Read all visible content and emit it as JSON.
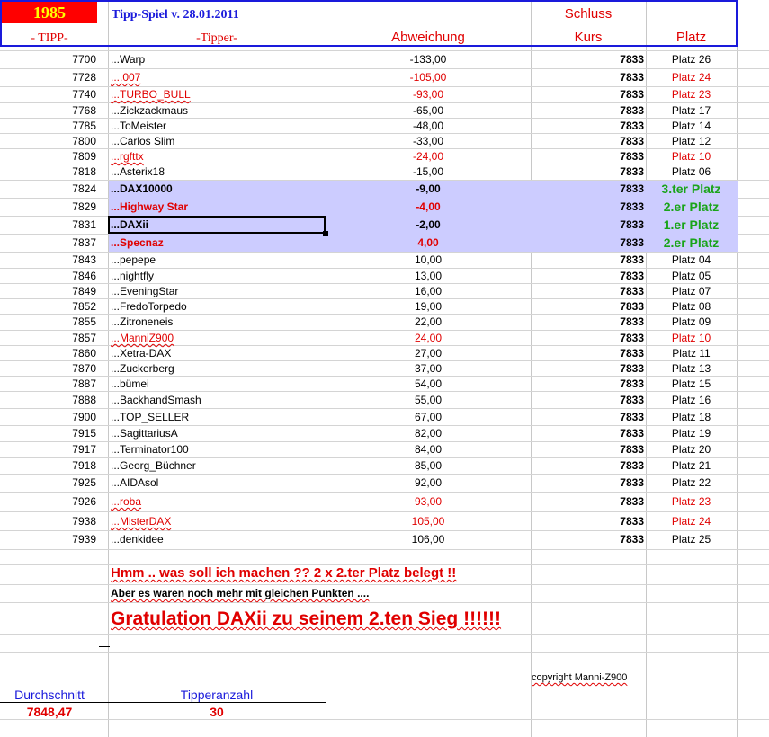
{
  "header": {
    "year": "1985",
    "title": "Tipp-Spiel v. 28.01.2011",
    "schluss": "Schluss",
    "col_tipp": "- TIPP-",
    "col_tipper": "-Tipper-",
    "col_abweichung": "Abweichung",
    "col_kurs": "Kurs",
    "col_platz": "Platz"
  },
  "rows": [
    {
      "tipp": "7700",
      "name": "...Warp",
      "abw": "-133,00",
      "kurs": "7833",
      "platz": "Platz 26",
      "style": "normal"
    },
    {
      "tipp": "7728",
      "name": "....007",
      "abw": "-105,00",
      "kurs": "7833",
      "platz": "Platz 24",
      "style": "red"
    },
    {
      "tipp": "7740",
      "name": "...TURBO_BULL",
      "abw": "-93,00",
      "kurs": "7833",
      "platz": "Platz 23",
      "style": "red"
    },
    {
      "tipp": "7768",
      "name": "...Zickzackmaus",
      "abw": "-65,00",
      "kurs": "7833",
      "platz": "Platz 17",
      "style": "normal"
    },
    {
      "tipp": "7785",
      "name": "...ToMeister",
      "abw": "-48,00",
      "kurs": "7833",
      "platz": "Platz 14",
      "style": "normal"
    },
    {
      "tipp": "7800",
      "name": "...Carlos Slim",
      "abw": "-33,00",
      "kurs": "7833",
      "platz": "Platz 12",
      "style": "normal"
    },
    {
      "tipp": "7809",
      "name": "...rgfttx",
      "abw": "-24,00",
      "kurs": "7833",
      "platz": "Platz 10",
      "style": "red"
    },
    {
      "tipp": "7818",
      "name": "...Asterix18",
      "abw": "-15,00",
      "kurs": "7833",
      "platz": "Platz 06",
      "style": "normal"
    },
    {
      "tipp": "7824",
      "name": "...DAX10000",
      "abw": "-9,00",
      "kurs": "7833",
      "platz": "3.ter Platz",
      "style": "hl"
    },
    {
      "tipp": "7829",
      "name": "...Highway Star",
      "abw": "-4,00",
      "kurs": "7833",
      "platz": "2.er Platz",
      "style": "hlred"
    },
    {
      "tipp": "7831",
      "name": "...DAXii",
      "abw": "-2,00",
      "kurs": "7833",
      "platz": "1.er Platz",
      "style": "hl"
    },
    {
      "tipp": "7837",
      "name": "...Specnaz",
      "abw": "4,00",
      "kurs": "7833",
      "platz": "2.er Platz",
      "style": "hlred"
    },
    {
      "tipp": "7843",
      "name": "...pepepe",
      "abw": "10,00",
      "kurs": "7833",
      "platz": "Platz 04",
      "style": "normal"
    },
    {
      "tipp": "7846",
      "name": "...nightfly",
      "abw": "13,00",
      "kurs": "7833",
      "platz": "Platz 05",
      "style": "normal"
    },
    {
      "tipp": "7849",
      "name": "...EveningStar",
      "abw": "16,00",
      "kurs": "7833",
      "platz": "Platz 07",
      "style": "normal"
    },
    {
      "tipp": "7852",
      "name": "...FredoTorpedo",
      "abw": "19,00",
      "kurs": "7833",
      "platz": "Platz 08",
      "style": "normal"
    },
    {
      "tipp": "7855",
      "name": "...Zitroneneis",
      "abw": "22,00",
      "kurs": "7833",
      "platz": "Platz 09",
      "style": "normal"
    },
    {
      "tipp": "7857",
      "name": "...ManniZ900",
      "abw": "24,00",
      "kurs": "7833",
      "platz": "Platz 10",
      "style": "red"
    },
    {
      "tipp": "7860",
      "name": "...Xetra-DAX",
      "abw": "27,00",
      "kurs": "7833",
      "platz": "Platz 11",
      "style": "normal"
    },
    {
      "tipp": "7870",
      "name": "...Zuckerberg",
      "abw": "37,00",
      "kurs": "7833",
      "platz": "Platz 13",
      "style": "normal"
    },
    {
      "tipp": "7887",
      "name": "...bümei",
      "abw": "54,00",
      "kurs": "7833",
      "platz": "Platz 15",
      "style": "normal"
    },
    {
      "tipp": "7888",
      "name": "...BackhandSmash",
      "abw": "55,00",
      "kurs": "7833",
      "platz": "Platz 16",
      "style": "normal"
    },
    {
      "tipp": "7900",
      "name": "...TOP_SELLER",
      "abw": "67,00",
      "kurs": "7833",
      "platz": "Platz 18",
      "style": "normal"
    },
    {
      "tipp": "7915",
      "name": "...SagittariusA",
      "abw": "82,00",
      "kurs": "7833",
      "platz": "Platz 19",
      "style": "normal"
    },
    {
      "tipp": "7917",
      "name": "...Terminator100",
      "abw": "84,00",
      "kurs": "7833",
      "platz": "Platz 20",
      "style": "normal"
    },
    {
      "tipp": "7918",
      "name": "...Georg_Büchner",
      "abw": "85,00",
      "kurs": "7833",
      "platz": "Platz 21",
      "style": "normal"
    },
    {
      "tipp": "7925",
      "name": "...AIDAsol",
      "abw": "92,00",
      "kurs": "7833",
      "platz": "Platz 22",
      "style": "normal"
    },
    {
      "tipp": "7926",
      "name": "...roba",
      "abw": "93,00",
      "kurs": "7833",
      "platz": "Platz 23",
      "style": "red"
    },
    {
      "tipp": "7938",
      "name": "...MisterDAX",
      "abw": "105,00",
      "kurs": "7833",
      "platz": "Platz 24",
      "style": "red"
    },
    {
      "tipp": "7939",
      "name": "...denkidee",
      "abw": "106,00",
      "kurs": "7833",
      "platz": "Platz 25",
      "style": "normal"
    }
  ],
  "notes": {
    "line1": "Hmm .. was soll ich machen ?? 2 x 2.ter Platz belegt !!",
    "line2": "Aber es waren noch mehr mit gleichen Punkten ....",
    "line3": "Gratulation  DAXii zu seinem 2.ten Sieg !!!!!!",
    "copyright": "copyright Manni-Z900"
  },
  "summary": {
    "avg_label": "Durchschnitt",
    "avg_value": "7848,47",
    "count_label": "Tipperanzahl",
    "count_value": "30"
  },
  "colors": {
    "red": "#e00000",
    "green": "#1aa41a",
    "header_blue": "#1a1adb",
    "highlight": "#ccccff",
    "year_bg": "#ff0000",
    "year_fg": "#ffff00"
  }
}
